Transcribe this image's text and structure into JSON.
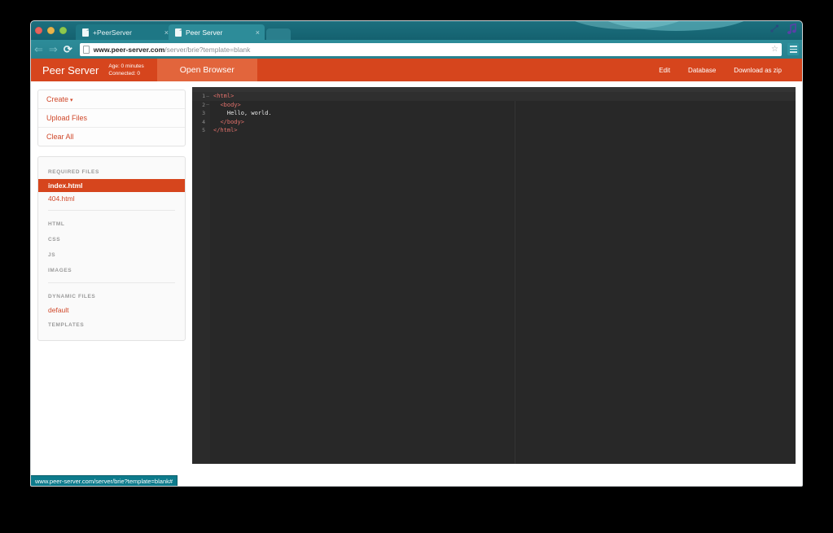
{
  "browser": {
    "tabs": [
      {
        "title": "+PeerServer",
        "active": false,
        "close_label": "×"
      },
      {
        "title": "Peer Server",
        "active": true,
        "close_label": "×"
      }
    ],
    "nav": {
      "back_label": "⇐",
      "forward_label": "⇒",
      "reload_label": "⟳"
    },
    "url_domain": "www.peer-server.com",
    "url_path": "/server/brie?template=blank",
    "star_label": "☆",
    "window_icons": [
      "share-icon",
      "music-note-icon"
    ]
  },
  "app_header": {
    "brand": "Peer Server",
    "age": "Age: 0 minutes",
    "connected": "Connected: 0",
    "open_browser": "Open Browser",
    "right_items": [
      "Edit",
      "Database",
      "Download as zip"
    ],
    "accent_color": "#d6451d",
    "accent_light": "#e2653c"
  },
  "sidebar": {
    "actions": [
      {
        "label": "Create",
        "caret": "▾"
      },
      {
        "label": "Upload Files",
        "caret": ""
      },
      {
        "label": "Clear All",
        "caret": ""
      }
    ],
    "required_files_header": "REQUIRED FILES",
    "required_files": [
      {
        "label": "index.html",
        "active": true
      },
      {
        "label": "404.html",
        "active": false
      }
    ],
    "type_groups": [
      "HTML",
      "CSS",
      "JS",
      "IMAGES"
    ],
    "dynamic_files_header": "DYNAMIC FILES",
    "dynamic_files": [
      {
        "label": "default"
      }
    ],
    "templates_header": "TEMPLATES"
  },
  "editor": {
    "lines": [
      {
        "num": "1",
        "fold": "–",
        "indent": "",
        "tag_open": "<html>",
        "text": "",
        "active": true
      },
      {
        "num": "2",
        "fold": "–",
        "indent": "  ",
        "tag_open": "<body>",
        "text": "",
        "active": false
      },
      {
        "num": "3",
        "fold": "",
        "indent": "    ",
        "tag_open": "",
        "text": "Hello, world.",
        "active": false
      },
      {
        "num": "4",
        "fold": "",
        "indent": "  ",
        "tag_open": "</body>",
        "text": "",
        "active": false
      },
      {
        "num": "5",
        "fold": "",
        "indent": "",
        "tag_open": "</html>",
        "text": "",
        "active": false
      }
    ],
    "background": "#282828",
    "tag_color": "#e2716b",
    "text_color": "#e8e8e8"
  },
  "status_bar": {
    "text": "www.peer-server.com/server/brie?template=blank#"
  }
}
